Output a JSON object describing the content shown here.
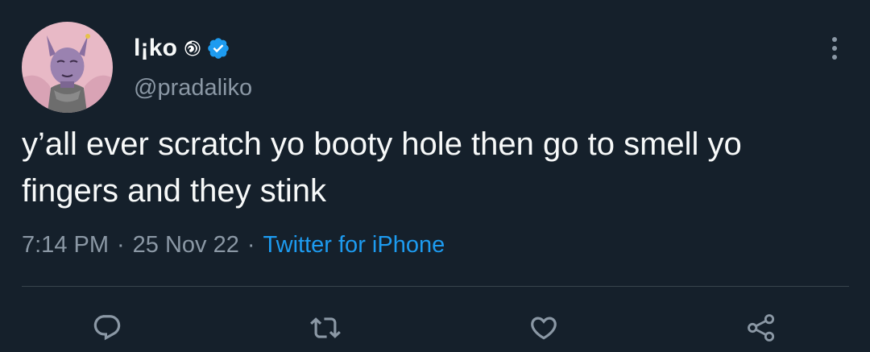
{
  "author": {
    "display_name": "l¡ko",
    "handle": "@pradaliko",
    "verified": true,
    "badge_emoji_icon": "cyclone-icon",
    "verified_icon": "verified-badge-icon",
    "avatar_icon": "beerus-avatar-icon"
  },
  "tweet": {
    "text": "y’all ever scratch yo booty hole then go to smell yo fingers and they stink",
    "time": "7:14 PM",
    "date": "25 Nov 22",
    "separator": "·",
    "source": "Twitter for iPhone"
  },
  "actions": {
    "reply_icon": "reply-icon",
    "retweet_icon": "retweet-icon",
    "like_icon": "heart-icon",
    "share_icon": "share-icon",
    "more_icon": "more-vertical-icon"
  },
  "colors": {
    "background": "#15202b",
    "text_primary": "#f7f9f9",
    "text_secondary": "#8b98a5",
    "accent": "#1d9bf0",
    "divider": "#38444d"
  }
}
